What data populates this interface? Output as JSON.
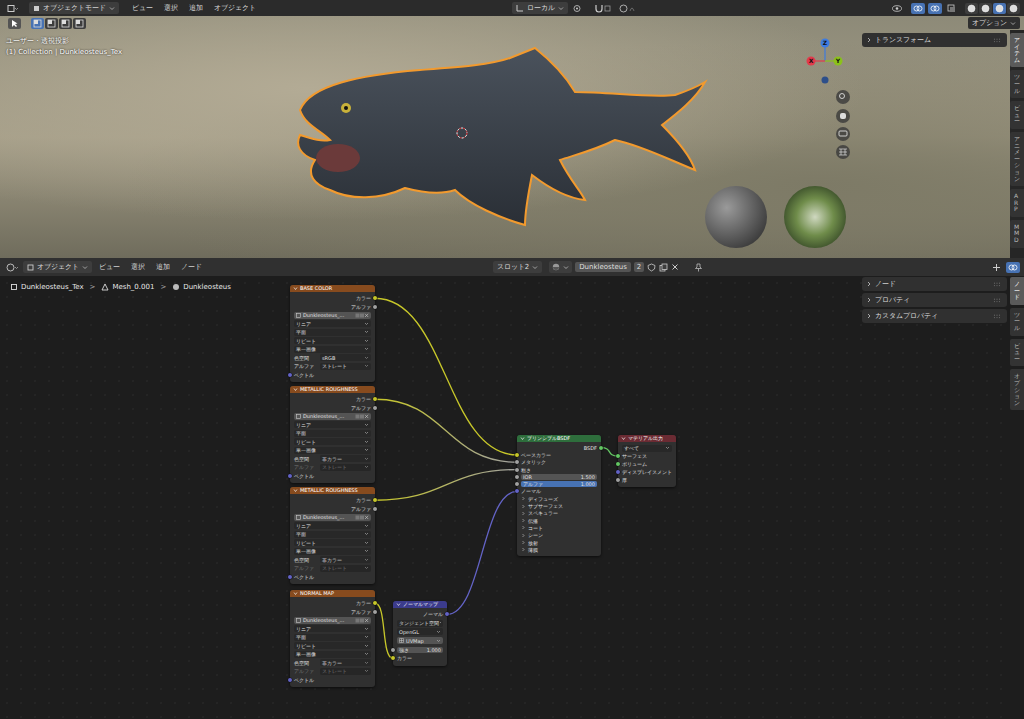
{
  "viewport": {
    "header": {
      "mode": "オブジェクトモード",
      "menus": [
        "ビュー",
        "選択",
        "追加",
        "オブジェクト"
      ],
      "orientation": "ローカル",
      "toggles": [
        {
          "selected": true
        },
        {
          "selected": true
        }
      ],
      "shading_modes": [
        {
          "selected": false
        },
        {
          "selected": false
        },
        {
          "selected": true
        },
        {
          "selected": false
        }
      ]
    },
    "tool_header": {
      "select_modes": [
        {
          "selected": true
        },
        {
          "selected": false
        },
        {
          "selected": false
        },
        {
          "selected": false
        }
      ],
      "options": "オプション"
    },
    "info": [
      "ユーザー・透視投影",
      "(1) Collection | Dunkleosteus_Tex"
    ],
    "gizmo": [
      {
        "label": "Z",
        "color": "#3d7be0"
      },
      {
        "label": "Y",
        "color": "#8bc21b"
      },
      {
        "label": "X",
        "color": "#e2394b"
      }
    ],
    "sidebar": {
      "panels": [
        {
          "label": "トランスフォーム",
          "expanded": false
        }
      ],
      "tabs": [
        {
          "label": "アイテム",
          "selected": true
        },
        {
          "label": "ツール",
          "selected": false
        },
        {
          "label": "ビュー",
          "selected": false
        },
        {
          "label": "アニメーション",
          "selected": false
        },
        {
          "label": "ARP",
          "selected": false
        },
        {
          "label": "MMD",
          "selected": false
        }
      ]
    }
  },
  "node_editor": {
    "header": {
      "type": "オブジェクト",
      "menus": [
        "ビュー",
        "選択",
        "追加",
        "ノード"
      ],
      "slot": "スロット2",
      "material": "Dunkleosteus",
      "users": "2"
    },
    "breadcrumb": {
      "items": [
        "Dunkleosteus_Tex",
        "Mesh_0.001",
        "Dunkleosteus"
      ],
      "separator": ">"
    },
    "sidebar": {
      "panels": [
        {
          "label": "ノード",
          "expanded": false
        },
        {
          "label": "プロパティ",
          "expanded": false
        },
        {
          "label": "カスタムプロパティ",
          "expanded": false
        }
      ],
      "tabs": [
        {
          "label": "ノード",
          "selected": true
        },
        {
          "label": "ツール",
          "selected": false
        },
        {
          "label": "ビュー",
          "selected": false
        },
        {
          "label": "オプション",
          "selected": false
        }
      ]
    },
    "nodes": [
      {
        "title": "BASE COLOR",
        "kind": "image",
        "rows": [
          {
            "kind": "output",
            "label": "カラー",
            "color": "#c7c729"
          },
          {
            "kind": "output",
            "label": "アルファ",
            "color": "#a1a1a1"
          },
          {
            "kind": "image",
            "label": "Dunkleosteus_..."
          },
          {
            "kind": "dropdown",
            "label": "リニア"
          },
          {
            "kind": "dropdown",
            "label": "平面"
          },
          {
            "kind": "dropdown",
            "label": "リピート"
          },
          {
            "kind": "dropdown",
            "label": "単一画像"
          },
          {
            "kind": "prop",
            "label": "色空間",
            "value": "sRGB",
            "disabled": false
          },
          {
            "kind": "prop",
            "label": "アルファ",
            "value": "ストレート",
            "disabled": false
          },
          {
            "kind": "input",
            "label": "ベクトル",
            "color": "#6363c7"
          }
        ]
      },
      {
        "title": "METALLIC ROUGHNESS",
        "kind": "image",
        "rows": [
          {
            "kind": "output",
            "label": "カラー",
            "color": "#c7c729"
          },
          {
            "kind": "output",
            "label": "アルファ",
            "color": "#a1a1a1"
          },
          {
            "kind": "image",
            "label": "Dunkleosteus_..."
          },
          {
            "kind": "dropdown",
            "label": "リニア"
          },
          {
            "kind": "dropdown",
            "label": "平面"
          },
          {
            "kind": "dropdown",
            "label": "リピート"
          },
          {
            "kind": "dropdown",
            "label": "単一画像"
          },
          {
            "kind": "prop",
            "label": "色空間",
            "value": "非カラー",
            "disabled": false
          },
          {
            "kind": "prop",
            "label": "アルファ",
            "value": "ストレート",
            "disabled": true
          },
          {
            "kind": "input",
            "label": "ベクトル",
            "color": "#6363c7"
          }
        ]
      },
      {
        "title": "METALLIC ROUGHNESS",
        "kind": "image",
        "rows": [
          {
            "kind": "output",
            "label": "カラー",
            "color": "#c7c729"
          },
          {
            "kind": "output",
            "label": "アルファ",
            "color": "#a1a1a1"
          },
          {
            "kind": "image",
            "label": "Dunkleosteus_..."
          },
          {
            "kind": "dropdown",
            "label": "リニア"
          },
          {
            "kind": "dropdown",
            "label": "平面"
          },
          {
            "kind": "dropdown",
            "label": "リピート"
          },
          {
            "kind": "dropdown",
            "label": "単一画像"
          },
          {
            "kind": "prop",
            "label": "色空間",
            "value": "非カラー",
            "disabled": false
          },
          {
            "kind": "prop",
            "label": "アルファ",
            "value": "ストレート",
            "disabled": true
          },
          {
            "kind": "input",
            "label": "ベクトル",
            "color": "#6363c7"
          }
        ]
      },
      {
        "title": "NORMAL MAP",
        "kind": "image",
        "rows": [
          {
            "kind": "output",
            "label": "カラー",
            "color": "#c7c729"
          },
          {
            "kind": "output",
            "label": "アルファ",
            "color": "#a1a1a1"
          },
          {
            "kind": "image",
            "label": "Dunkleosteus_..."
          },
          {
            "kind": "dropdown",
            "label": "リニア"
          },
          {
            "kind": "dropdown",
            "label": "平面"
          },
          {
            "kind": "dropdown",
            "label": "リピート"
          },
          {
            "kind": "dropdown",
            "label": "単一画像"
          },
          {
            "kind": "prop",
            "label": "色空間",
            "value": "非カラー",
            "disabled": false
          },
          {
            "kind": "prop",
            "label": "アルファ",
            "value": "ストレート",
            "disabled": true
          },
          {
            "kind": "input",
            "label": "ベクトル",
            "color": "#6363c7"
          }
        ]
      },
      {
        "title": "プリンシプルBSDF",
        "kind": "bsdf",
        "rows": [
          {
            "kind": "output",
            "label": "BSDF",
            "color": "#63c763"
          },
          {
            "kind": "input",
            "label": "ベースカラー",
            "color": "#c7c729"
          },
          {
            "kind": "input",
            "label": "メタリック",
            "color": "#a1a1a1"
          },
          {
            "kind": "input",
            "label": "粗さ",
            "color": "#a1a1a1"
          },
          {
            "kind": "value",
            "label": "IOR",
            "value": "1.500",
            "color": "#a1a1a1"
          },
          {
            "kind": "value",
            "label": "アルファ",
            "value": "1.000",
            "level": 1,
            "color": "#a1a1a1"
          },
          {
            "kind": "input",
            "label": "ノーマル",
            "color": "#6363c7"
          },
          {
            "kind": "panel",
            "label": "ディフューズ",
            "expanded": false
          },
          {
            "kind": "panel",
            "label": "サブサーフェス",
            "expanded": false
          },
          {
            "kind": "panel",
            "label": "スペキュラー",
            "expanded": false
          },
          {
            "kind": "panel",
            "label": "伝播",
            "expanded": false
          },
          {
            "kind": "panel",
            "label": "コート",
            "expanded": false
          },
          {
            "kind": "panel",
            "label": "シーン",
            "expanded": false
          },
          {
            "kind": "panel",
            "label": "放射",
            "expanded": false
          },
          {
            "kind": "panel",
            "label": "薄膜",
            "expanded": false
          }
        ]
      },
      {
        "title": "マテリアル出力",
        "kind": "output",
        "rows": [
          {
            "kind": "dropdown",
            "label": "すべて"
          },
          {
            "kind": "input",
            "label": "サーフェス",
            "color": "#63c763"
          },
          {
            "kind": "input",
            "label": "ボリューム",
            "color": "#63c763"
          },
          {
            "kind": "input",
            "label": "ディスプレイスメント",
            "color": "#6363c7"
          },
          {
            "kind": "input",
            "label": "厚",
            "color": "#a1a1a1"
          }
        ]
      },
      {
        "title": "ノーマルマップ",
        "kind": "normal",
        "rows": [
          {
            "kind": "output",
            "label": "ノーマル",
            "color": "#6363c7"
          },
          {
            "kind": "dropdown",
            "label": "タンジェント空間"
          },
          {
            "kind": "dropdown",
            "label": "OpenGL"
          },
          {
            "kind": "uv",
            "label": "UVMap"
          },
          {
            "kind": "value",
            "label": "強さ",
            "value": "1.000",
            "color": "#a1a1a1"
          },
          {
            "kind": "input",
            "label": "カラー",
            "color": "#c7c729"
          }
        ]
      }
    ],
    "links": [
      {
        "from_node": 0,
        "from_row": 0,
        "to_node": 4,
        "to_row": 1,
        "color": "#c7c729",
        "end_color": "#c7c729"
      },
      {
        "from_node": 1,
        "from_row": 0,
        "to_node": 4,
        "to_row": 2,
        "color": "#c7c729",
        "end_color": "#a1a1a1"
      },
      {
        "from_node": 2,
        "from_row": 0,
        "to_node": 4,
        "to_row": 3,
        "color": "#c7c729",
        "end_color": "#a1a1a1"
      },
      {
        "from_node": 3,
        "from_row": 0,
        "to_node": 6,
        "to_row": 5,
        "color": "#c7c729",
        "end_color": "#c7c729"
      },
      {
        "from_node": 6,
        "from_row": 0,
        "to_node": 4,
        "to_row": 6,
        "color": "#6363c7",
        "end_color": "#6363c7"
      },
      {
        "from_node": 4,
        "from_row": 0,
        "to_node": 5,
        "to_row": 1,
        "color": "#63c763",
        "end_color": "#63c763"
      }
    ]
  }
}
